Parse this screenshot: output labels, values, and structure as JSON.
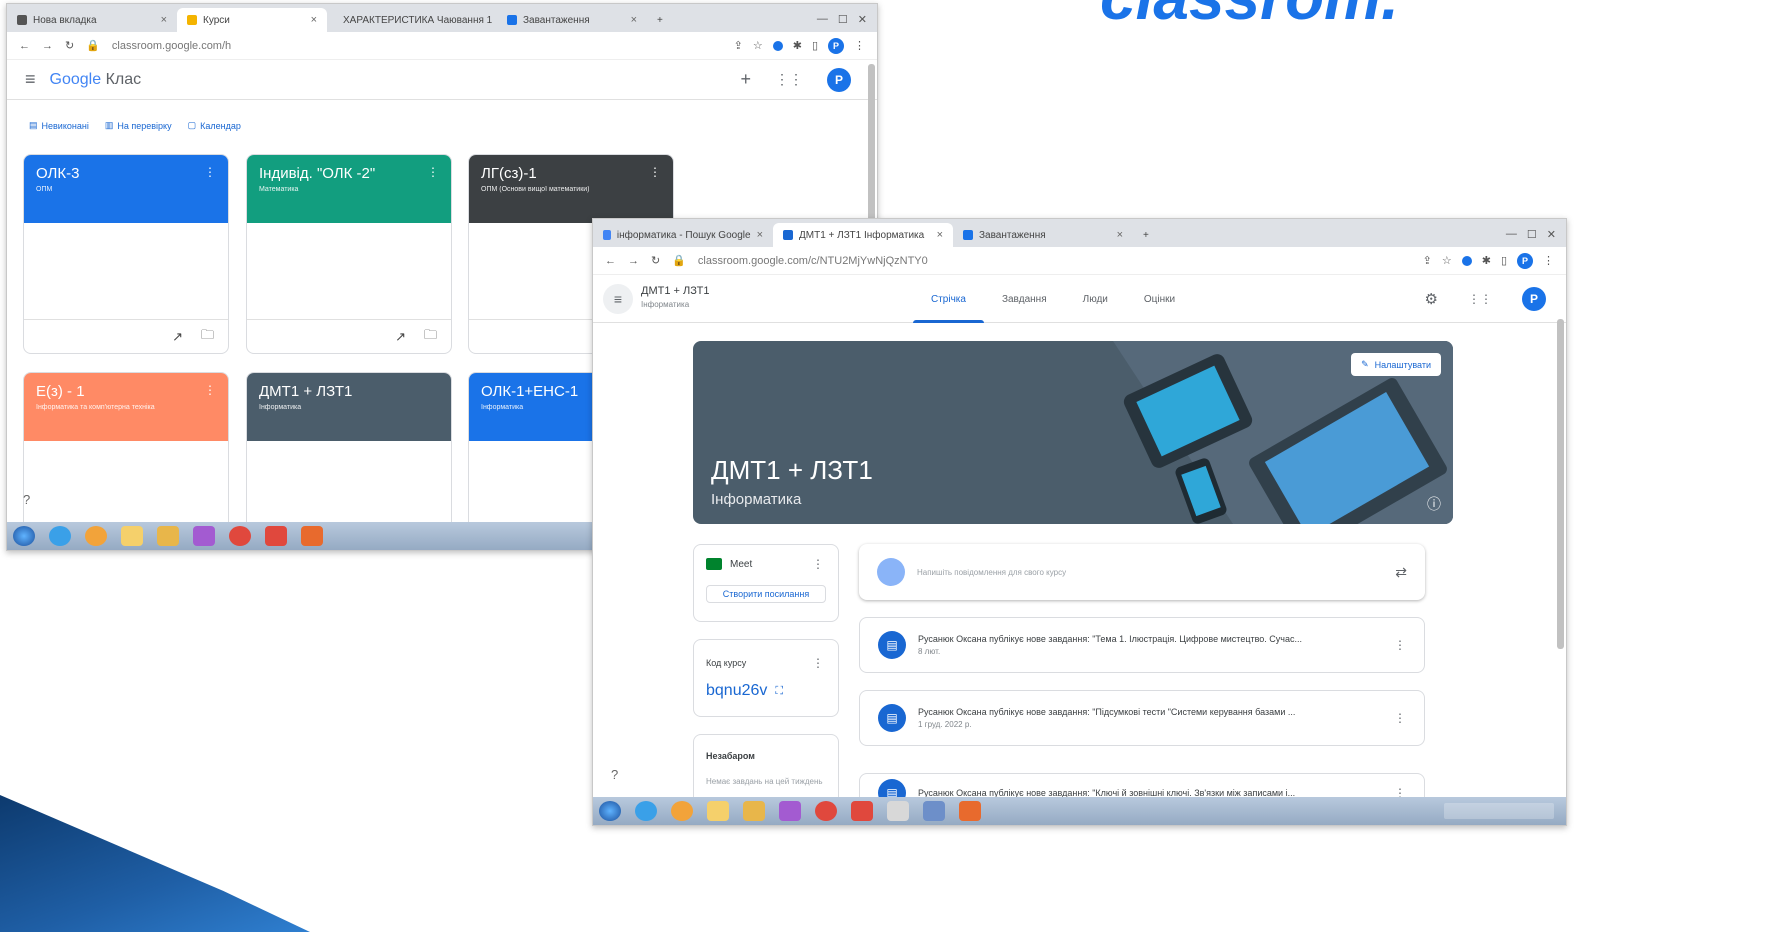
{
  "slide": {
    "title": "classrom."
  },
  "win1": {
    "tabs": [
      "Нова вкладка",
      "Курси",
      "ХАРАКТЕРИСТИКА Чаювання 1",
      "Завантаження"
    ],
    "url": "classroom.google.com/h",
    "app": {
      "logo_google": "Google",
      "logo_suffix": "Клас"
    },
    "avatar": "P",
    "subnav": [
      "Невиконані",
      "На перевірку",
      "Календар"
    ],
    "cards": [
      {
        "title": "ОЛК-3",
        "subtitle": "ОПМ",
        "color": "#1a73e8"
      },
      {
        "title": "Індивід. \"ОЛК -2\"",
        "subtitle": "Математика",
        "color": "#129e7f"
      },
      {
        "title": "ЛГ(сз)-1",
        "subtitle": "ОПМ (Основи вищої математики)",
        "color": "#3c4043"
      },
      {
        "title": "Е(з) - 1",
        "subtitle": "Інформатика та комп'ютерна техніка",
        "color": "#ff8a65"
      },
      {
        "title": "ДМТ1 + ЛЗТ1",
        "subtitle": "Інформатика",
        "color": "#4b5d6b"
      },
      {
        "title": "ОЛК-1+ЕНС-1",
        "subtitle": "Інформатика",
        "color": "#1a73e8"
      }
    ]
  },
  "win2": {
    "tabs": [
      "інформатика - Пошук Google",
      "ДМТ1 + ЛЗТ1 Інформатика",
      "Завантаження"
    ],
    "url": "classroom.google.com/c/NTU2MjYwNjQzNTY0",
    "avatar": "P",
    "class_name": "ДМТ1 + ЛЗТ1",
    "class_subject": "Інформатика",
    "navtabs": [
      "Стрічка",
      "Завдання",
      "Люди",
      "Оцінки"
    ],
    "banner": {
      "title": "ДМТ1 + ЛЗТ1",
      "subtitle": "Інформатика",
      "customize": "Налаштувати"
    },
    "meet": {
      "label": "Meet",
      "button": "Створити посилання"
    },
    "course_code": {
      "label": "Код курсу",
      "value": "bqnu26v"
    },
    "upcoming": {
      "label": "Незабаром",
      "text": "Немає завдань на цей тиждень"
    },
    "announce_placeholder": "Напишіть повідомлення для свого курсу",
    "posts": [
      {
        "text": "Русанюк Оксана публікує нове завдання: \"Тема 1. Ілюстрація. Цифрове мистецтво. Сучас...",
        "date": "8 лют."
      },
      {
        "text": "Русанюк Оксана публікує нове завдання: \"Підсумкові тести \"Системи керування базами ...",
        "date": "1 груд. 2022 р."
      },
      {
        "text": "Русанюк Оксана публікує нове завдання: \"Ключі й зовнішні ключі. Зв'язки між записами і...",
        "date": ""
      }
    ]
  }
}
